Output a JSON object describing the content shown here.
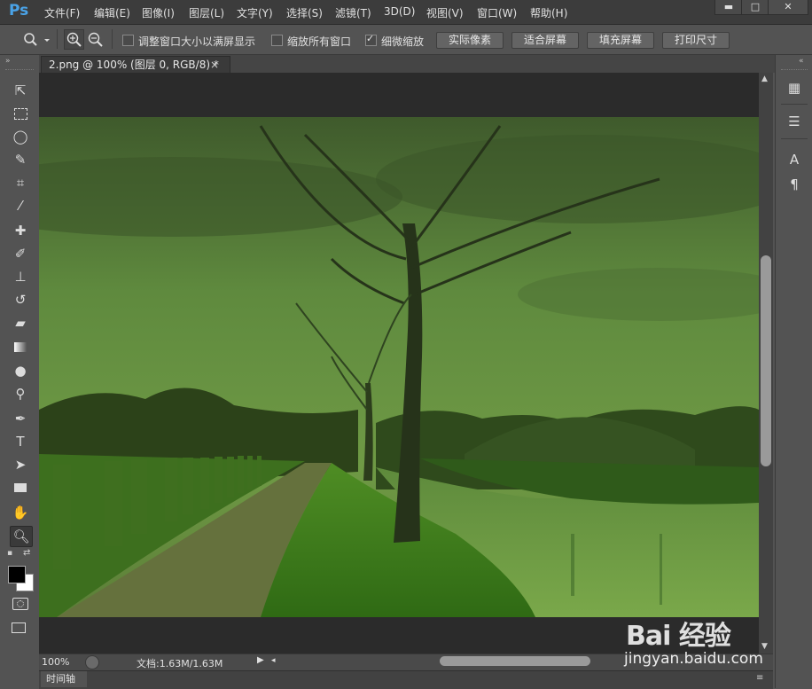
{
  "app": {
    "logo": "Ps"
  },
  "menu": [
    "文件(F)",
    "编辑(E)",
    "图像(I)",
    "图层(L)",
    "文字(Y)",
    "选择(S)",
    "滤镜(T)",
    "3D(D)",
    "视图(V)",
    "窗口(W)",
    "帮助(H)"
  ],
  "window_controls": {
    "minimize": "▬",
    "maximize": "□",
    "close": "✕"
  },
  "options": {
    "resize_windows_label": "调整窗口大小以满屏显示",
    "resize_windows_checked": false,
    "zoom_all_label": "缩放所有窗口",
    "zoom_all_checked": false,
    "scrubby_zoom_label": "细微缩放",
    "scrubby_zoom_checked": true,
    "actual_pixels": "实际像素",
    "fit_screen": "适合屏幕",
    "fill_screen": "填充屏幕",
    "print_size": "打印尺寸"
  },
  "document": {
    "tab_title": "2.png @ 100% (图层 0, RGB/8) *",
    "close_glyph": "×",
    "zoom": "100%",
    "doc_info": "文档:1.63M/1.63M",
    "timeline_tab": "时间轴"
  },
  "tools": [
    "move-tool",
    "marquee-tool",
    "lasso-tool",
    "quick-select-tool",
    "crop-tool",
    "eyedropper-tool",
    "healing-brush-tool",
    "brush-tool",
    "clone-stamp-tool",
    "history-brush-tool",
    "eraser-tool",
    "gradient-tool",
    "blur-tool",
    "dodge-tool",
    "pen-tool",
    "type-tool",
    "path-select-tool",
    "rectangle-tool",
    "hand-tool",
    "zoom-tool"
  ],
  "colors": {
    "foreground": "#000000",
    "background": "#ffffff",
    "accent": "#4aa3e8"
  },
  "watermark": {
    "brand": "Bai 经验",
    "url": "jingyan.baidu.com"
  }
}
